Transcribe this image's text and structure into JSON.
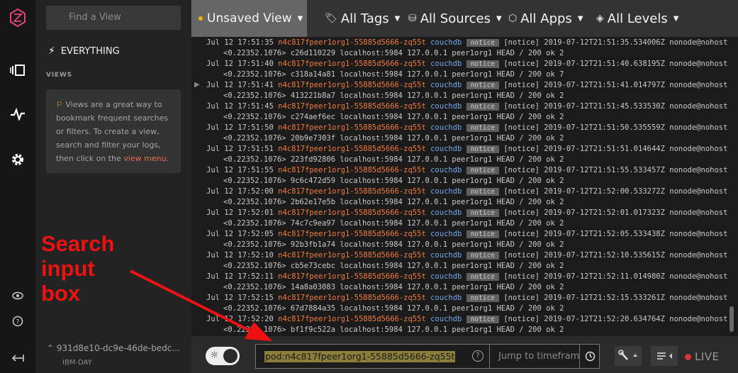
{
  "sidebar": {
    "find_placeholder": "Find a View",
    "everything_label": "EVERYTHING",
    "views_heading": "VIEWS",
    "views_help_pre": "Views are a great way to bookmark frequent searches or filters. To create a view, search and filter your logs, then click on the ",
    "views_help_link": "view menu",
    "views_help_post": ".",
    "current_view": "931d8e10-dc9e-46de-bedc...",
    "current_view_sub": "IBM-DAY"
  },
  "topbar": {
    "view_name": "Unsaved View",
    "filters": [
      "All Tags",
      "All Sources",
      "All Apps",
      "All Levels"
    ]
  },
  "log_entries": [
    {
      "ts": "Jul 12 17:51:35",
      "pod": "n4c817fpeer1org1-55885d5666-zq55t",
      "app": "couchdb",
      "level": "notice",
      "msg": " [notice] 2019-07-12T21:51:35.534006Z nonode@nohost",
      "cont": "<0.22352.1076> c26d110229 localhost:5984 127.0.0.1 peer1org1 HEAD / 200 ok 2"
    },
    {
      "ts": "Jul 12 17:51:40",
      "pod": "n4c817fpeer1org1-55885d5666-zq55t",
      "app": "couchdb",
      "level": "notice",
      "msg": " [notice] 2019-07-12T21:51:40.638195Z nonode@nohost",
      "cont": "<0.22352.1076> c318a14a81 localhost:5984 127.0.0.1 peer1org1 HEAD / 200 ok 7"
    },
    {
      "ts": "Jul 12 17:51:41",
      "pod": "n4c817fpeer1org1-55885d5666-zq55t",
      "app": "couchdb",
      "level": "notice",
      "msg": " [notice] 2019-07-12T21:51:41.014797Z nonode@nohost",
      "cont": "<0.22352.1076> 413221b8a7 localhost:5984 127.0.0.1 peer1org1 HEAD / 200 ok 2"
    },
    {
      "ts": "Jul 12 17:51:45",
      "pod": "n4c817fpeer1org1-55885d5666-zq55t",
      "app": "couchdb",
      "level": "notice",
      "msg": " [notice] 2019-07-12T21:51:45.533530Z nonode@nohost",
      "cont": "<0.22352.1076> c274aef6ec localhost:5984 127.0.0.1 peer1org1 HEAD / 200 ok 2"
    },
    {
      "ts": "Jul 12 17:51:50",
      "pod": "n4c817fpeer1org1-55885d5666-zq55t",
      "app": "couchdb",
      "level": "notice",
      "msg": " [notice] 2019-07-12T21:51:50.535559Z nonode@nohost",
      "cont": "<0.22352.1076> 20b9e7303f localhost:5984 127.0.0.1 peer1org1 HEAD / 200 ok 2"
    },
    {
      "ts": "Jul 12 17:51:51",
      "pod": "n4c817fpeer1org1-55885d5666-zq55t",
      "app": "couchdb",
      "level": "notice",
      "msg": " [notice] 2019-07-12T21:51:51.014644Z nonode@nohost",
      "cont": "<0.22352.1076> 223fd92806 localhost:5984 127.0.0.1 peer1org1 HEAD / 200 ok 2"
    },
    {
      "ts": "Jul 12 17:51:55",
      "pod": "n4c817fpeer1org1-55885d5666-zq55t",
      "app": "couchdb",
      "level": "notice",
      "msg": " [notice] 2019-07-12T21:51:55.533457Z nonode@nohost",
      "cont": "<0.22352.1076> 9c6c472d59 localhost:5984 127.0.0.1 peer1org1 HEAD / 200 ok 2"
    },
    {
      "ts": "Jul 12 17:52:00",
      "pod": "n4c817fpeer1org1-55885d5666-zq55t",
      "app": "couchdb",
      "level": "notice",
      "msg": " [notice] 2019-07-12T21:52:00.533272Z nonode@nohost",
      "cont": "<0.22352.1076> 2b62e17e5b localhost:5984 127.0.0.1 peer1org1 HEAD / 200 ok 2"
    },
    {
      "ts": "Jul 12 17:52:01",
      "pod": "n4c817fpeer1org1-55885d5666-zq55t",
      "app": "couchdb",
      "level": "notice",
      "msg": " [notice] 2019-07-12T21:52:01.017323Z nonode@nohost",
      "cont": "<0.22352.1076> 74c7c9ea97 localhost:5984 127.0.0.1 peer1org1 HEAD / 200 ok 2"
    },
    {
      "ts": "Jul 12 17:52:05",
      "pod": "n4c817fpeer1org1-55885d5666-zq55t",
      "app": "couchdb",
      "level": "notice",
      "msg": " [notice] 2019-07-12T21:52:05.533438Z nonode@nohost",
      "cont": "<0.22352.1076> 92b3fb1a74 localhost:5984 127.0.0.1 peer1org1 HEAD / 200 ok 2"
    },
    {
      "ts": "Jul 12 17:52:10",
      "pod": "n4c817fpeer1org1-55885d5666-zq55t",
      "app": "couchdb",
      "level": "notice",
      "msg": " [notice] 2019-07-12T21:52:10.535615Z nonode@nohost",
      "cont": "<0.22352.1076> cb5e73cebc localhost:5984 127.0.0.1 peer1org1 HEAD / 200 ok 2"
    },
    {
      "ts": "Jul 12 17:52:11",
      "pod": "n4c817fpeer1org1-55885d5666-zq55t",
      "app": "couchdb",
      "level": "notice",
      "msg": " [notice] 2019-07-12T21:52:11.014980Z nonode@nohost",
      "cont": "<0.22352.1076> 14a8a03083 localhost:5984 127.0.0.1 peer1org1 HEAD / 200 ok 2"
    },
    {
      "ts": "Jul 12 17:52:15",
      "pod": "n4c817fpeer1org1-55885d5666-zq55t",
      "app": "couchdb",
      "level": "notice",
      "msg": " [notice] 2019-07-12T21:52:15.533261Z nonode@nohost",
      "cont": "<0.22352.1076> 67d7884a35 localhost:5984 127.0.0.1 peer1org1 HEAD / 200 ok 2"
    },
    {
      "ts": "Jul 12 17:52:20",
      "pod": "n4c817fpeer1org1-55885d5666-zq55t",
      "app": "couchdb",
      "level": "notice",
      "msg": " [notice] 2019-07-12T21:52:20.634764Z nonode@nohost",
      "cont": "<0.22352.1076> bf1f9c522a localhost:5984 127.0.0.1 peer1org1 HEAD / 200 ok 2"
    }
  ],
  "bottombar": {
    "search_value": "pod:n4c817fpeer1org1-55885d5666-zq55t",
    "jump_placeholder": "Jump to timeframe",
    "live_label": "LIVE"
  },
  "annotation": {
    "lines": [
      "Search",
      "input",
      "box"
    ]
  },
  "colors": {
    "accent_red": "#ee1111",
    "pod_orange": "#f07a3c",
    "app_blue": "#74a8e8",
    "highlight": "#8b7d3a"
  },
  "icons": [
    "logo-icon",
    "views-icon",
    "graph-icon",
    "gear-icon",
    "eye-icon",
    "help-icon",
    "logout-icon",
    "flash-icon",
    "flag-icon",
    "tag-icon",
    "database-icon",
    "apps-icon",
    "layers-icon",
    "sun-icon",
    "clock-icon",
    "wrench-icon",
    "lines-icon"
  ]
}
